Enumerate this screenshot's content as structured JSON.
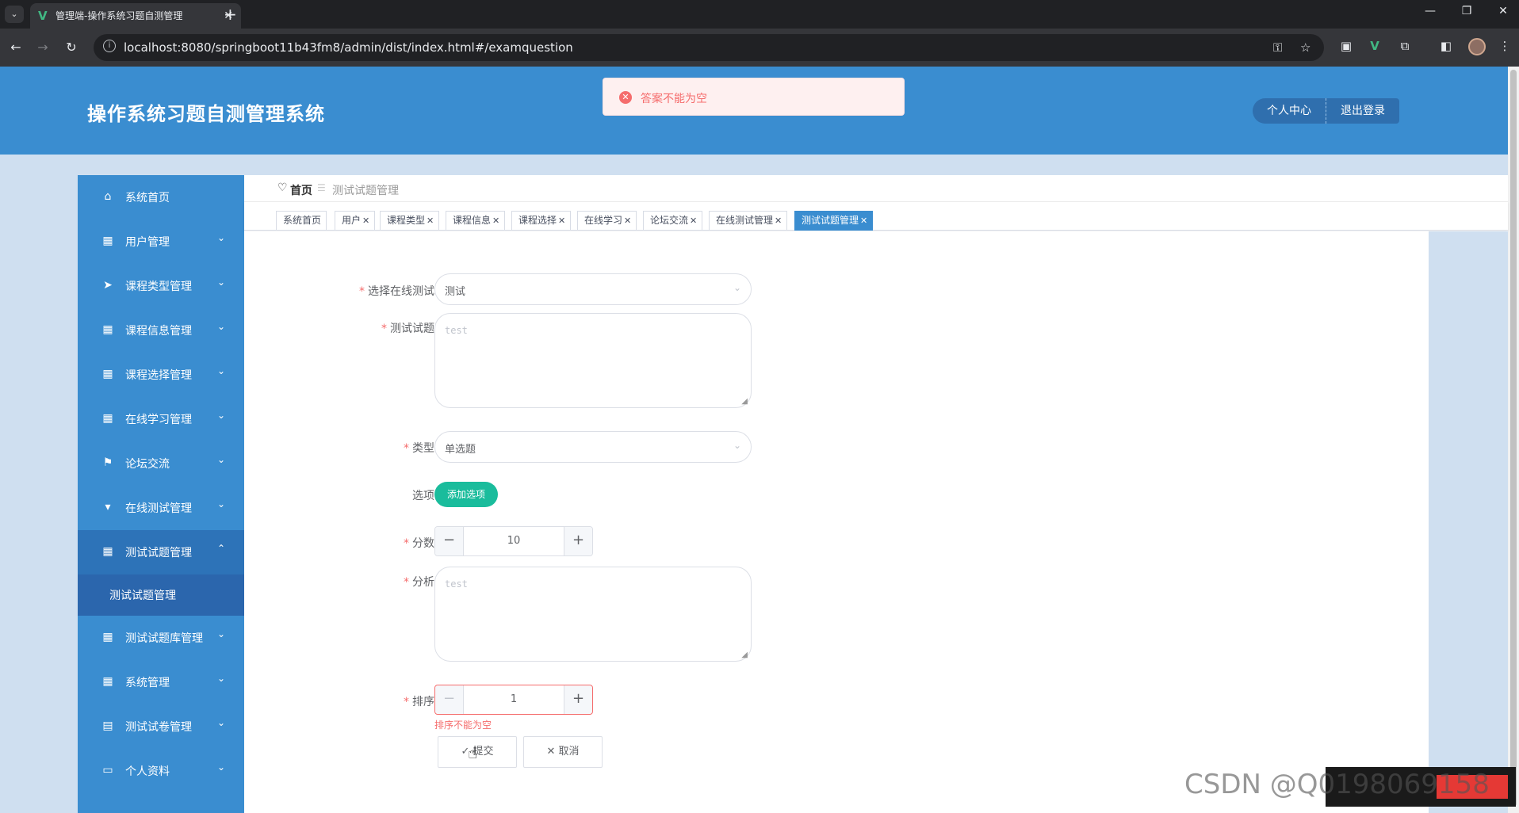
{
  "browser": {
    "tab_title": "管理端-操作系统习题自测管理",
    "url": "localhost:8080/springboot11b43fm8/admin/dist/index.html#/examquestion"
  },
  "header": {
    "title": "操作系统习题自测管理系统",
    "profile_btn": "个人中心",
    "logout_btn": "退出登录"
  },
  "toast": {
    "message": "答案不能为空"
  },
  "sidebar": {
    "items": [
      {
        "label": "系统首页",
        "icon": "home-icon"
      },
      {
        "label": "用户管理",
        "icon": "grid-icon"
      },
      {
        "label": "课程类型管理",
        "icon": "send-icon"
      },
      {
        "label": "课程信息管理",
        "icon": "grid-icon"
      },
      {
        "label": "课程选择管理",
        "icon": "grid-icon"
      },
      {
        "label": "在线学习管理",
        "icon": "grid-icon"
      },
      {
        "label": "论坛交流",
        "icon": "flag-icon"
      },
      {
        "label": "在线测试管理",
        "icon": "pin-icon"
      },
      {
        "label": "测试试题管理",
        "icon": "grid-icon"
      },
      {
        "label": "测试试题库管理",
        "icon": "grid-icon"
      },
      {
        "label": "系统管理",
        "icon": "grid-icon"
      },
      {
        "label": "测试试卷管理",
        "icon": "clipboard-icon"
      },
      {
        "label": "个人资料",
        "icon": "calendar-icon"
      }
    ],
    "submenu": "测试试题管理"
  },
  "breadcrumb": {
    "home": "首页",
    "current": "测试试题管理"
  },
  "tags": [
    "系统首页",
    "用户",
    "课程类型",
    "课程信息",
    "课程选择",
    "在线学习",
    "论坛交流",
    "在线测试管理",
    "测试试题管理"
  ],
  "form": {
    "exam_label": "选择在线测试",
    "exam_value": "测试",
    "question_label": "测试试题",
    "question_value": "test",
    "type_label": "类型",
    "type_value": "单选题",
    "options_label": "选项",
    "add_option_btn": "添加选项",
    "score_label": "分数",
    "score_value": "10",
    "analysis_label": "分析",
    "analysis_value": "test",
    "order_label": "排序",
    "order_value": "1",
    "order_error": "排序不能为空",
    "submit_btn": "提交",
    "cancel_btn": "取消"
  },
  "watermark": "CSDN @Q0198069158"
}
